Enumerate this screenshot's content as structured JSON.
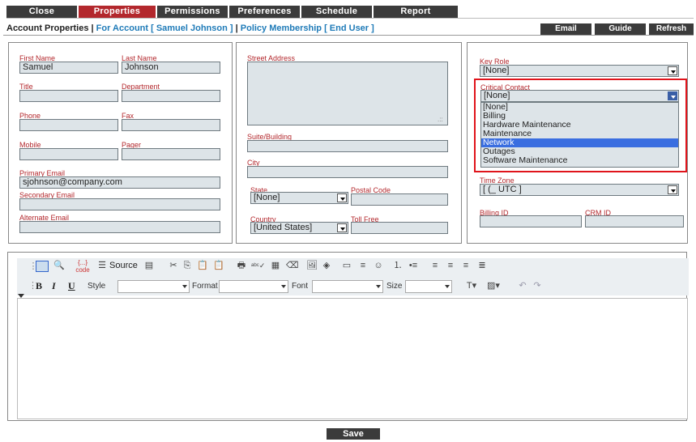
{
  "tabs": [
    {
      "label": "Close"
    },
    {
      "label": "Properties"
    },
    {
      "label": "Permissions"
    },
    {
      "label": "Preferences"
    },
    {
      "label": "Schedule"
    },
    {
      "label": "Report"
    }
  ],
  "subbar": {
    "title": "Account Properties",
    "sep1": " | ",
    "for_account": "For Account [ Samuel Johnson ]",
    "sep2": " | ",
    "policy": "Policy Membership [ End User ]"
  },
  "actions": {
    "email": "Email",
    "guide": "Guide",
    "refresh": "Refresh"
  },
  "form": {
    "first_name": {
      "label": "First Name",
      "value": "Samuel"
    },
    "last_name": {
      "label": "Last Name",
      "value": "Johnson"
    },
    "title": {
      "label": "Title",
      "value": ""
    },
    "department": {
      "label": "Department",
      "value": ""
    },
    "phone": {
      "label": "Phone",
      "value": ""
    },
    "fax": {
      "label": "Fax",
      "value": ""
    },
    "mobile": {
      "label": "Mobile",
      "value": ""
    },
    "pager": {
      "label": "Pager",
      "value": ""
    },
    "primary_email": {
      "label": "Primary Email",
      "value": "sjohnson@company.com"
    },
    "secondary_email": {
      "label": "Secondary Email",
      "value": ""
    },
    "alternate_email": {
      "label": "Alternate Email",
      "value": ""
    },
    "street": {
      "label": "Street Address",
      "value": ""
    },
    "suite": {
      "label": "Suite/Building",
      "value": ""
    },
    "city": {
      "label": "City",
      "value": ""
    },
    "state": {
      "label": "State",
      "value": "[None]"
    },
    "postal": {
      "label": "Postal Code",
      "value": ""
    },
    "country": {
      "label": "Country",
      "value": "[United States]"
    },
    "toll_free": {
      "label": "Toll Free",
      "value": ""
    },
    "key_role": {
      "label": "Key Role",
      "value": "[None]"
    },
    "critical_contact": {
      "label": "Critical Contact",
      "value": "[None]",
      "options": [
        "[None]",
        "Billing",
        "Hardware Maintenance",
        "Maintenance",
        "Network",
        "Outages",
        "Software Maintenance"
      ],
      "highlighted": "Network"
    },
    "time_zone": {
      "label": "Time Zone",
      "value": "[ (_ UTC ]"
    },
    "billing_id": {
      "label": "Billing ID",
      "value": ""
    },
    "crm_id": {
      "label": "CRM ID",
      "value": ""
    }
  },
  "editor": {
    "source_label": "Source",
    "bold": "B",
    "italic": "I",
    "underline": "U",
    "style_label": "Style",
    "format_label": "Format",
    "font_label": "Font",
    "size_label": "Size"
  },
  "save_label": "Save",
  "colors": {
    "tab": "#3b3b3b",
    "active_tab": "#b3282d",
    "label": "#b3282d",
    "link": "#1f7bb8",
    "field": "#dde4e8",
    "highlight_box": "#e0141b"
  }
}
